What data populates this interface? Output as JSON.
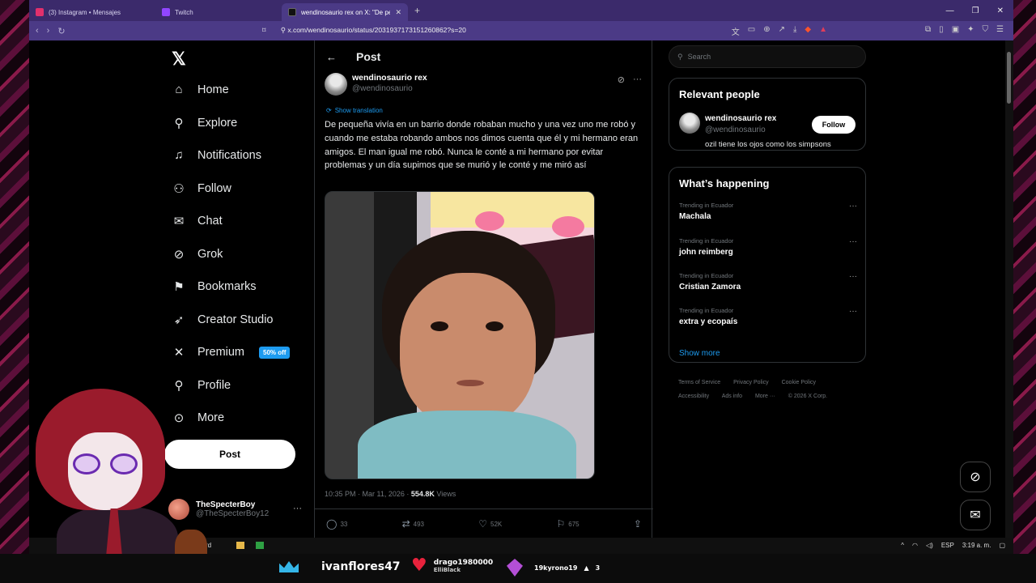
{
  "browser": {
    "tabs": [
      {
        "title": "(3) Instagram • Mensajes",
        "color": "#e1306c"
      },
      {
        "title": "Twitch",
        "color": "#9146ff"
      },
      {
        "title": "wendinosaurio rex on X: \"De peq",
        "color": "#000000"
      }
    ],
    "url": "x.com/wendinosaurio/status/2031937173151260862?s=20"
  },
  "leftnav": {
    "items": [
      {
        "label": "Home",
        "icon": "home-icon"
      },
      {
        "label": "Explore",
        "icon": "search-icon"
      },
      {
        "label": "Notifications",
        "icon": "bell-icon"
      },
      {
        "label": "Follow",
        "icon": "person-plus-icon"
      },
      {
        "label": "Chat",
        "icon": "envelope-icon"
      },
      {
        "label": "Grok",
        "icon": "grok-icon"
      },
      {
        "label": "Bookmarks",
        "icon": "bookmark-icon"
      },
      {
        "label": "Creator Studio",
        "icon": "rocket-icon"
      },
      {
        "label": "Premium",
        "icon": "x-icon"
      },
      {
        "label": "Profile",
        "icon": "person-icon"
      },
      {
        "label": "More",
        "icon": "more-circle-icon"
      }
    ],
    "premium_badge": "50% off",
    "post_button": "Post",
    "account": {
      "name": "TheSpecterBoy",
      "handle": "@TheSpecterBoy12"
    }
  },
  "main": {
    "header": "Post",
    "tweet": {
      "name": "wendinosaurio rex",
      "handle": "@wendinosaurio",
      "translate": "Show translation",
      "text": "De pequeña vivía en un barrio donde robaban mucho y una vez uno me robó y cuando me estaba robando ambos nos dimos cuenta que él y mi hermano eran amigos. El man igual me robó. Nunca le conté a mi hermano por evitar problemas y un día supimos que se murió y le conté y me miró así",
      "time": "10:35 PM · Mar 11, 2026 · ",
      "views_count": "554.8K",
      "views_label": " Views",
      "replies": "33",
      "reposts": "493",
      "likes": "52K",
      "bookmarks": "675"
    }
  },
  "right": {
    "search_placeholder": "Search",
    "relevant": {
      "title": "Relevant people",
      "name": "wendinosaurio rex",
      "handle": "@wendinosaurio",
      "bio": "ozil tiene los ojos como los simpsons",
      "follow": "Follow"
    },
    "happening": {
      "title": "What’s happening",
      "trends": [
        {
          "context": "Trending in Ecuador",
          "topic": "Machala"
        },
        {
          "context": "Trending in Ecuador",
          "topic": "john reimberg"
        },
        {
          "context": "Trending in Ecuador",
          "topic": "Cristian Zamora"
        },
        {
          "context": "Trending in Ecuador",
          "topic": "extra y ecopaís"
        }
      ],
      "show_more": "Show more"
    },
    "footer": [
      "Terms of Service",
      "Privacy Policy",
      "Cookie Policy",
      "Accessibility",
      "Ads info",
      "More ···",
      "© 2026 X Corp."
    ]
  },
  "taskbar": {
    "discord": "Discord",
    "lang": "ESP",
    "time": "3:19 a. m."
  },
  "overlay": {
    "user1": "ivanflores47",
    "user2": "drago1980000",
    "user2_sub": "ElliBlack",
    "user3": "19kyrono19",
    "user3_count": "3"
  }
}
